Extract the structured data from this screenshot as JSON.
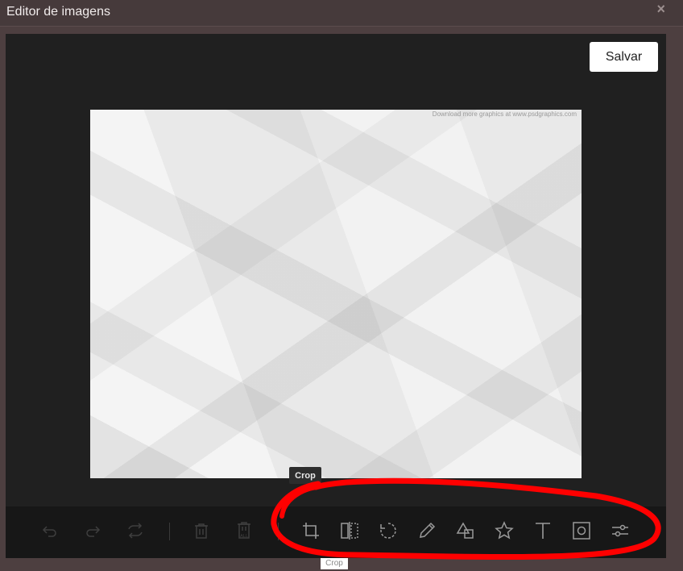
{
  "window": {
    "title": "Editor de imagens",
    "close_glyph": "×"
  },
  "actions": {
    "save_label": "Salvar"
  },
  "image": {
    "watermark": "Download more graphics at www.psdgraphics.com"
  },
  "toolbar": {
    "tooltip": "Crop",
    "icons": [
      "undo-icon",
      "redo-icon",
      "reset-icon",
      "delete-icon",
      "delete-all-icon",
      "crop-icon",
      "flip-icon",
      "rotate-icon",
      "draw-icon",
      "shape-icon",
      "icon-icon",
      "text-icon",
      "mask-icon",
      "filter-icon"
    ]
  },
  "annotation": {
    "color": "#ff0000",
    "stray_label": "Crop"
  }
}
